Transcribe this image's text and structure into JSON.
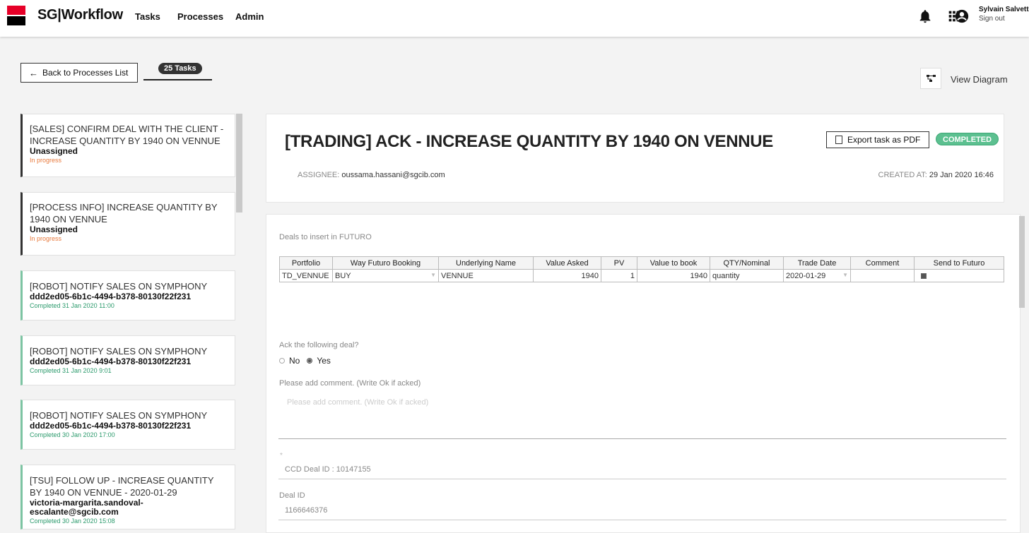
{
  "nav": {
    "brand": "SG|Workflow",
    "items": [
      "Tasks",
      "Processes",
      "Admin"
    ],
    "user_name": "Sylvain Salvetti",
    "sign_out": "Sign out",
    "icons": [
      "bell-icon",
      "apps-grid-icon",
      "account-circle-icon"
    ]
  },
  "actions": {
    "back_label": "Back to Processes List",
    "tasks_count": "25 Tasks",
    "view_diagram": "View Diagram"
  },
  "tasks": [
    {
      "title": "[SALES] CONFIRM DEAL WITH THE CLIENT - INCREASE QUANTITY BY 1940 ON VENNUE",
      "sub": "Unassigned",
      "status": "In progress"
    },
    {
      "title": "[PROCESS INFO] INCREASE QUANTITY BY 1940 ON VENNUE",
      "sub": "Unassigned",
      "status": "In progress"
    },
    {
      "title": "[ROBOT] NOTIFY SALES ON SYMPHONY",
      "sub": "ddd2ed05-6b1c-4494-b378-80130f22f231",
      "status": "Completed 31 Jan 2020 11:00"
    },
    {
      "title": "[ROBOT] NOTIFY SALES ON SYMPHONY",
      "sub": "ddd2ed05-6b1c-4494-b378-80130f22f231",
      "status": "Completed 31 Jan 2020 9:01"
    },
    {
      "title": "[ROBOT] NOTIFY SALES ON SYMPHONY",
      "sub": "ddd2ed05-6b1c-4494-b378-80130f22f231",
      "status": "Completed 30 Jan 2020 17:00"
    },
    {
      "title": "[TSU] FOLLOW UP - INCREASE QUANTITY BY 1940 ON VENNUE - 2020-01-29",
      "sub": "victoria-margarita.sandoval-escalante@sgcib.com",
      "status": "Completed 30 Jan 2020 15:08"
    }
  ],
  "task_detail": {
    "title": "[TRADING] ACK - INCREASE QUANTITY BY 1940 ON VENNUE",
    "export_label": "Export task as PDF",
    "status_badge": "COMPLETED",
    "assignee_label": "ASSIGNEE:",
    "assignee": "oussama.hassani@sgcib.com",
    "created_label": "CREATED AT:",
    "created": "29 Jan 2020 16:46"
  },
  "form": {
    "deals_label": "Deals to insert in FUTURO",
    "columns": [
      "Portfolio",
      "Way Futuro Booking",
      "Underlying Name",
      "Value Asked",
      "PV",
      "Value to book",
      "QTY/Nominal",
      "Trade Date",
      "Comment",
      "Send to Futuro"
    ],
    "row": {
      "portfolio": "TD_VENNUE",
      "way": "BUY",
      "underlying": "VENNUE",
      "value_asked": "1940",
      "pv": "1",
      "value_to_book": "1940",
      "qty": "quantity",
      "trade_date": "2020-01-29",
      "comment": "",
      "send_to_futuro": true
    },
    "ack_question": "Ack the following deal?",
    "ack_options": [
      "No",
      "Yes"
    ],
    "ack_selected": "Yes",
    "comment_label": "Please add comment. (Write Ok if acked)",
    "comment_placeholder": "Please add comment. (Write Ok if acked)",
    "required_marker": "*",
    "ccd_deal": "CCD Deal ID : 10147155",
    "deal_id_label": "Deal ID",
    "deal_id": "1166646376"
  },
  "colors": {
    "brand_red": "#e60028",
    "completed_green": "#5cc090",
    "in_progress_orange": "#e87a3d"
  }
}
